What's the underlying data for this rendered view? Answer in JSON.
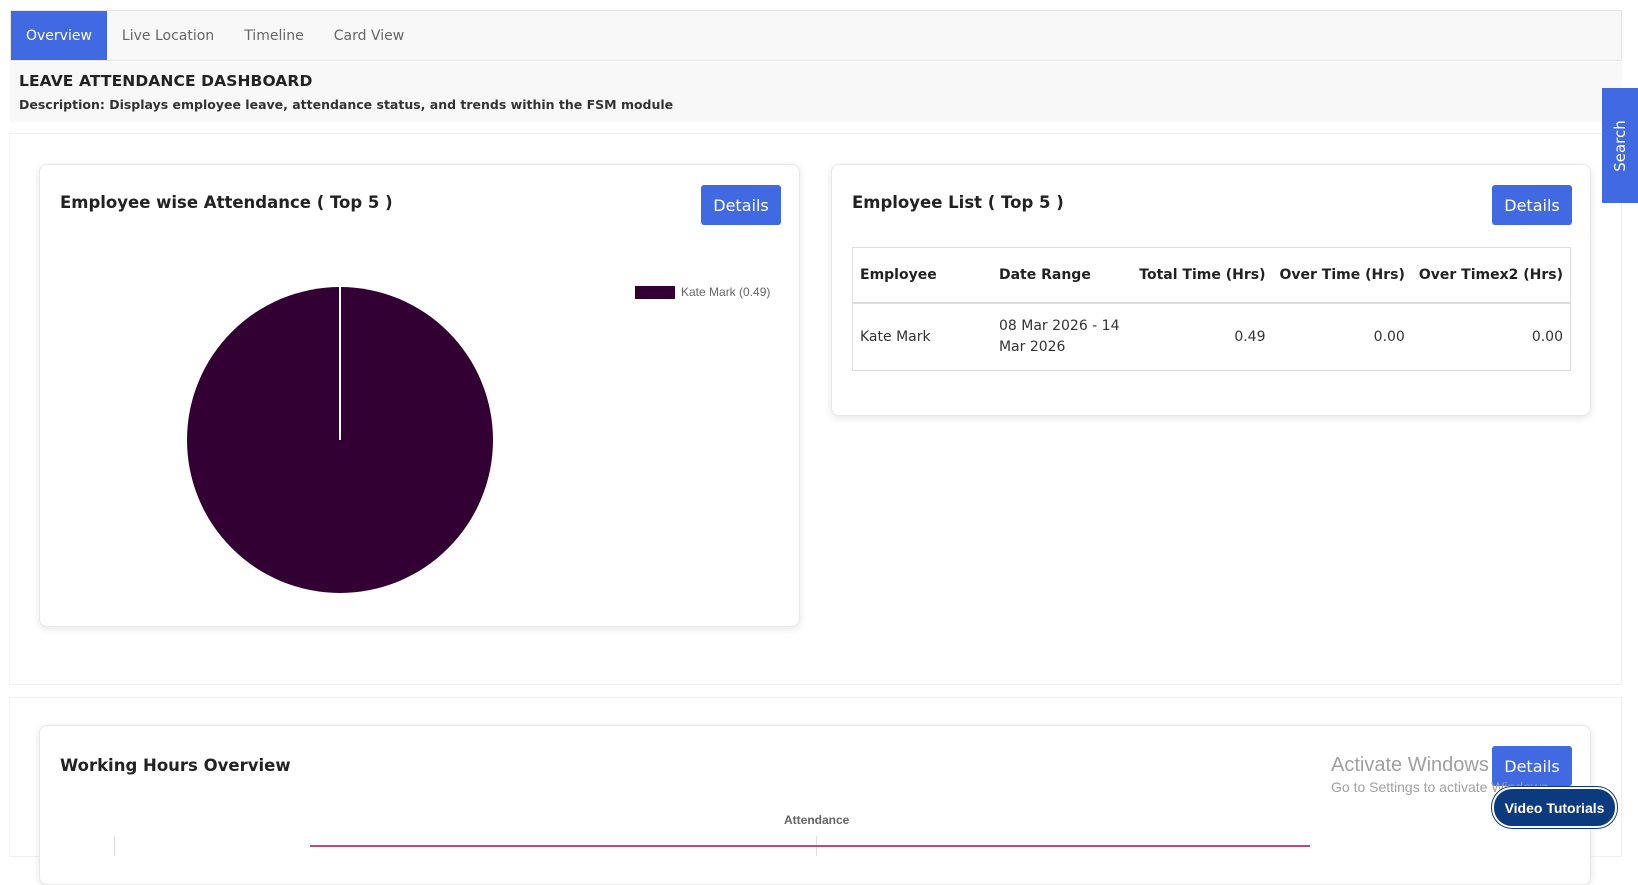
{
  "tabs": [
    {
      "label": "Overview",
      "active": true
    },
    {
      "label": "Live Location",
      "active": false
    },
    {
      "label": "Timeline",
      "active": false
    },
    {
      "label": "Card View",
      "active": false
    }
  ],
  "header": {
    "title": "LEAVE ATTENDANCE DASHBOARD",
    "description": "Description: Displays employee leave, attendance status, and trends within the FSM module"
  },
  "attendance_card": {
    "title": "Employee wise Attendance ( Top 5 )",
    "details_label": "Details",
    "legend_label": "Kate Mark (0.49)",
    "slice_color": "#330033"
  },
  "employee_card": {
    "title": "Employee List ( Top 5 )",
    "details_label": "Details",
    "columns": [
      "Employee",
      "Date Range",
      "Total Time (Hrs)",
      "Over Time (Hrs)",
      "Over Timex2 (Hrs)"
    ],
    "rows": [
      {
        "employee": "Kate Mark",
        "date_range": "08 Mar 2026 - 14 Mar 2026",
        "total": "0.49",
        "overtime": "0.00",
        "overtime2": "0.00"
      }
    ]
  },
  "working_card": {
    "title": "Working Hours Overview",
    "details_label": "Details",
    "chart_label": "Attendance"
  },
  "search_tab": {
    "label": "Search"
  },
  "watermark": {
    "line1": "Activate Windows",
    "line2": "Go to Settings to activate Windows."
  },
  "video_button": {
    "label": "Video Tutorials"
  },
  "colors": {
    "accent": "#4169e1",
    "slice": "#330033",
    "video": "#0b3a7e"
  },
  "chart_data": {
    "type": "pie",
    "categories": [
      "Kate Mark"
    ],
    "values": [
      0.49
    ],
    "legend": [
      "Kate Mark (0.49)"
    ],
    "legend_position": "top-right"
  }
}
